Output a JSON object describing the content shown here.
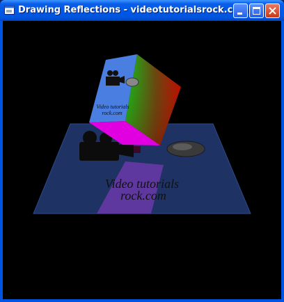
{
  "window": {
    "title": "Drawing Reflections - videotutorialsrock.com",
    "controls": [
      "minimize",
      "maximize",
      "close"
    ]
  },
  "scene": {
    "cube_face_text_line1": "Video tutorials",
    "cube_face_text_line2": "rock.com",
    "floor_text_line1": "Video tutorials",
    "floor_text_line2": "rock.com",
    "colors": {
      "cube_front": "#3f74dd",
      "cube_top": "#e000e0",
      "floor": "#1b2f5c",
      "background": "#000000"
    }
  }
}
